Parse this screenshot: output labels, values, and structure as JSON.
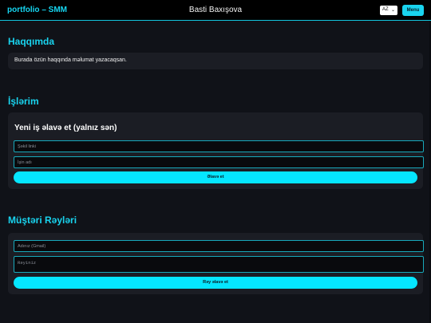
{
  "header": {
    "brand": "portfolio – SMM",
    "owner": "Basti Baxışova",
    "lang": {
      "selected": "AZ"
    },
    "menu_label": "Menu"
  },
  "about": {
    "title": "Haqqımda",
    "text": "Burada özün haqqında məlumat yazacaqsan."
  },
  "works": {
    "title": "İşlərim",
    "card_title": "Yeni iş əlavə et (yalnız sən)",
    "image_placeholder": "Şəkil linki",
    "name_placeholder": "İşin adı",
    "add_label": "Əlavə et"
  },
  "reviews": {
    "title": "Müştəri Rəyləri",
    "name_placeholder": "Adınız (Gmail)",
    "review_placeholder": "Rəyiniz",
    "add_label": "Rəy əlavə et"
  }
}
